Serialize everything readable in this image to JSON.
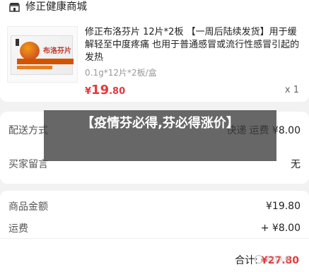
{
  "store": {
    "icon": "shop-icon",
    "name": "修正健康商城"
  },
  "product": {
    "title": "修正布洛芬片 12片*2板 【一周后陆续发货】用于缓解轻至中度疼痛 也用于普通感冒或流行性感冒引起的发热",
    "image_text": "布洛芬片",
    "spec": "0.1g*12片*2板/盒",
    "price_currency": "¥",
    "price_int": "19",
    "price_dec": ".80",
    "quantity": "x 1"
  },
  "delivery": {
    "label": "配送方式",
    "method": "快递",
    "fee": "运费 ¥8.00"
  },
  "message": {
    "label": "买家留言",
    "value": "无"
  },
  "totals": {
    "subtotal_label": "商品金额",
    "subtotal_value": "¥19.80",
    "freight_label": "运费",
    "freight_value": "+ ¥8.00",
    "total_label": "合计:",
    "total_value": "¥27.80"
  },
  "banner": {
    "text": "【疫情芬必得,芬必得涨价】"
  },
  "watermark": {
    "text": "今日头条"
  },
  "colors": {
    "accent": "#e4393c",
    "banner_bg": "#3c3c3c"
  }
}
